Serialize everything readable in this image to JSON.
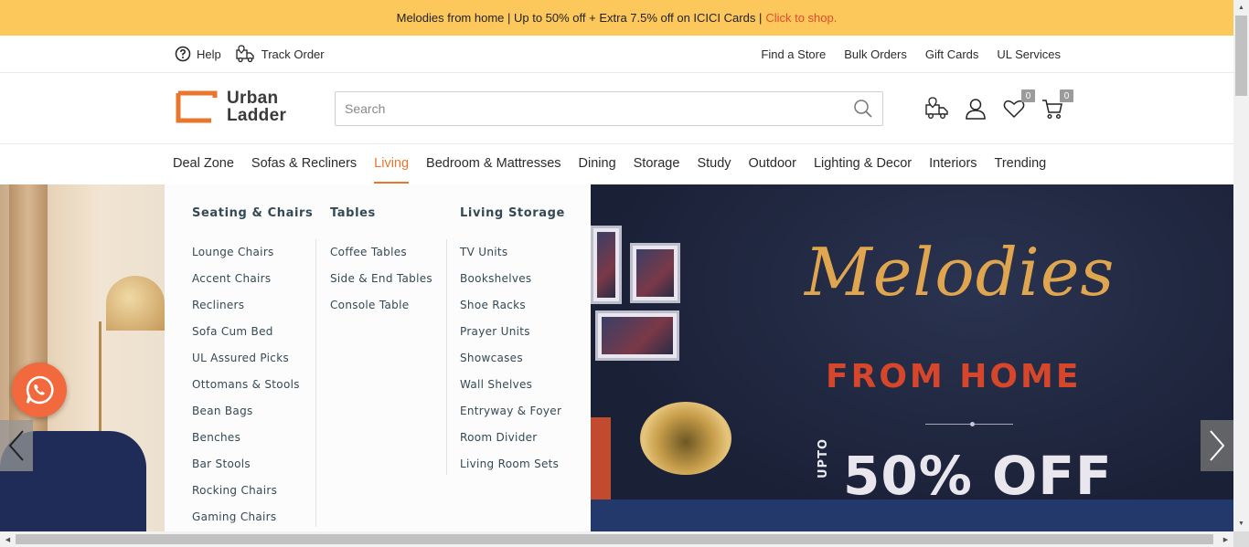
{
  "promo": {
    "text": "Melodies from home | Up to 50% off + Extra 7.5% off on ICICI Cards |",
    "link": "Click to shop."
  },
  "utility": {
    "help": "Help",
    "track_order": "Track Order",
    "links": [
      "Find a Store",
      "Bulk Orders",
      "Gift Cards",
      "UL Services"
    ]
  },
  "header": {
    "logo_line1": "Urban",
    "logo_line2": "Ladder",
    "search_placeholder": "Search",
    "wishlist_count": "0",
    "cart_count": "0",
    "icons": [
      "delivery-truck-icon",
      "user-icon",
      "heart-icon",
      "cart-icon"
    ]
  },
  "nav": {
    "items": [
      "Deal Zone",
      "Sofas & Recliners",
      "Living",
      "Bedroom & Mattresses",
      "Dining",
      "Storage",
      "Study",
      "Outdoor",
      "Lighting & Decor",
      "Interiors",
      "Trending"
    ],
    "active": "Living"
  },
  "menu": {
    "columns": [
      {
        "title": "Seating & Chairs",
        "items": [
          "Lounge Chairs",
          "Accent Chairs",
          "Recliners",
          "Sofa Cum Bed",
          "UL Assured Picks",
          "Ottomans & Stools",
          "Bean Bags",
          "Benches",
          "Bar Stools",
          "Rocking Chairs",
          "Gaming Chairs"
        ]
      },
      {
        "title": "Tables",
        "items": [
          "Coffee Tables",
          "Side & End Tables",
          "Console Table"
        ]
      },
      {
        "title": "Living Storage",
        "items": [
          "TV Units",
          "Bookshelves",
          "Shoe Racks",
          "Prayer Units",
          "Showcases",
          "Wall Shelves",
          "Entryway & Foyer",
          "Room Divider",
          "Living Room Sets"
        ]
      }
    ]
  },
  "hero": {
    "script_title": "Melodies",
    "subtitle": "FROM HOME",
    "upto": "UPTO",
    "offer": "50% OFF"
  },
  "colors": {
    "promo_bg": "#fcc85c",
    "accent": "#e8762d",
    "link_red": "#e8492e",
    "whatsapp_bg": "#f2693d",
    "menu_text": "#344955"
  }
}
